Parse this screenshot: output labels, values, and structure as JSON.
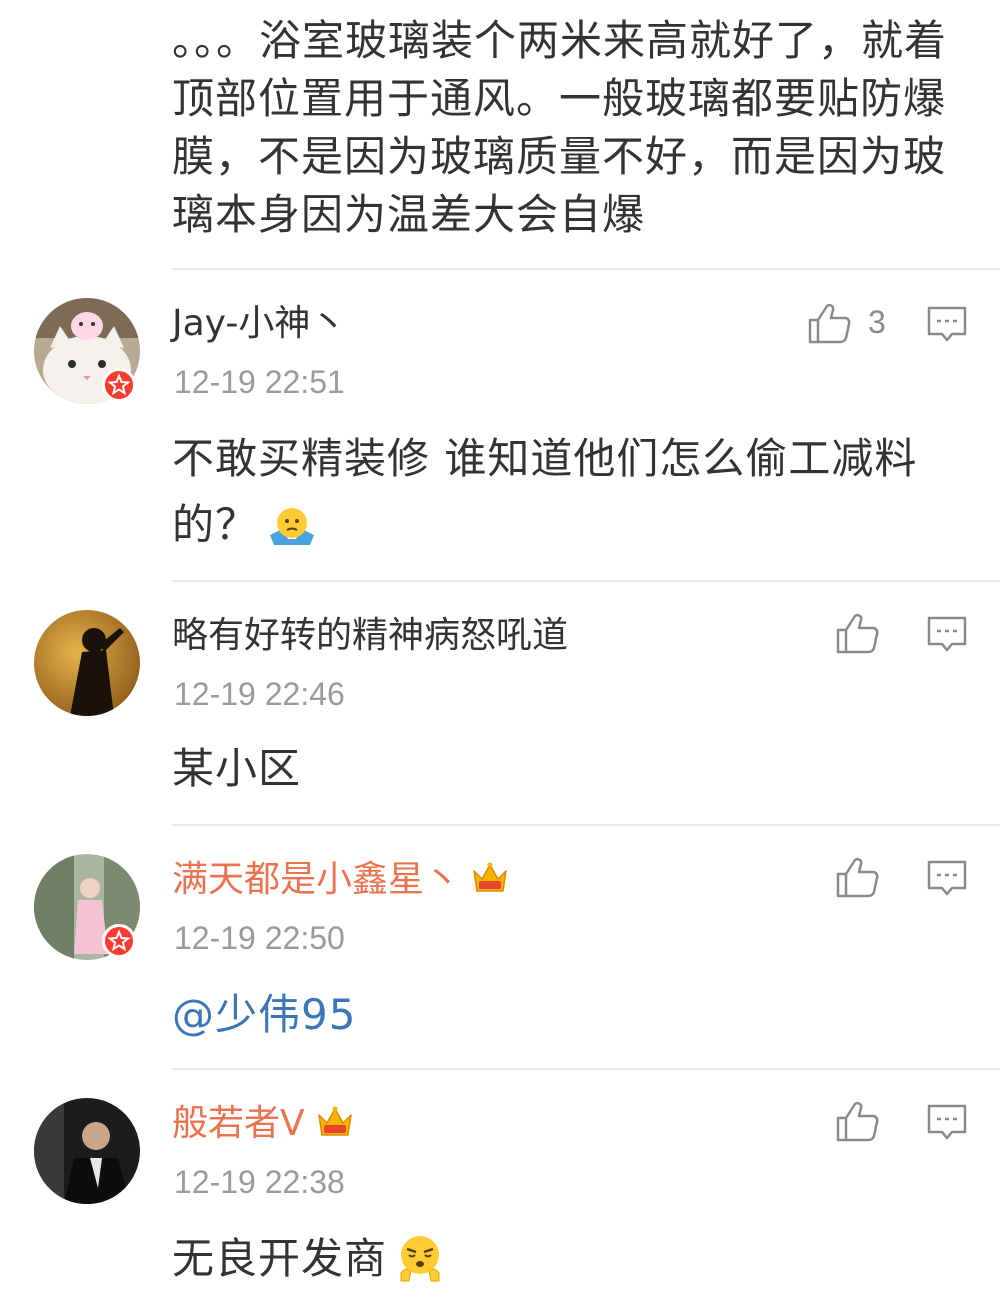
{
  "top_comment_tail": {
    "text": "。。。浴室玻璃装个两米来高就好了，就着顶部位置用于通风。一般玻璃都要贴防爆膜，不是因为玻璃质量不好，而是因为玻璃本身因为温差大会自爆"
  },
  "comments": [
    {
      "username": "Jay-小神丶",
      "time": "12-19 22:51",
      "likes": "3",
      "text": "不敢买精装修  谁知道他们怎么偷工减料的？",
      "emoji_icon": "shrug-emoji-icon"
    },
    {
      "username": "略有好转的精神病怒吼道",
      "time": "12-19 22:46",
      "text": "某小区"
    },
    {
      "username": "满天都是小鑫星丶",
      "time": "12-19 22:50",
      "text": "@少伟95",
      "badge_icon": "crown-vip-icon"
    },
    {
      "username": "般若者V",
      "time": "12-19 22:38",
      "text": "无良开发商",
      "badge_icon": "crown-vip-icon",
      "emoji_icon": "angry-emoji-icon"
    }
  ],
  "colors": {
    "text": "#333333",
    "meta": "#9a9a9a",
    "vip_name": "#eb7350",
    "mention": "#3b76b8",
    "divider": "#e9e9e9",
    "badge_red": "#ff3b30"
  }
}
